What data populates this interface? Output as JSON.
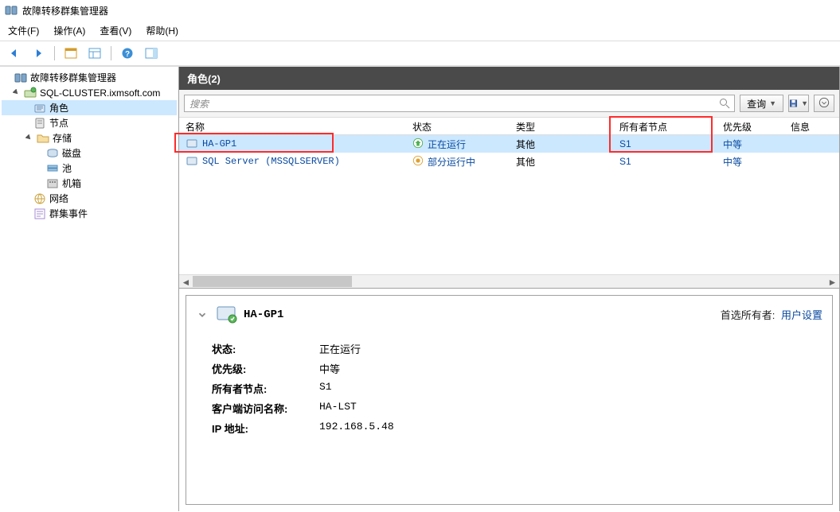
{
  "window": {
    "title": "故障转移群集管理器"
  },
  "menubar": {
    "file": "文件(F)",
    "action": "操作(A)",
    "view": "查看(V)",
    "help": "帮助(H)"
  },
  "tree": {
    "root": "故障转移群集管理器",
    "cluster": "SQL-CLUSTER.ixmsoft.com",
    "roles": "角色",
    "nodes": "节点",
    "storage": "存储",
    "disks": "磁盘",
    "pools": "池",
    "enclosures": "机箱",
    "networks": "网络",
    "events": "群集事件"
  },
  "panel": {
    "title": "角色(2)"
  },
  "search": {
    "placeholder": "搜索",
    "query_btn": "查询"
  },
  "columns": {
    "name": "名称",
    "status": "状态",
    "type": "类型",
    "owner": "所有者节点",
    "priority": "优先级",
    "info": "信息"
  },
  "rows": [
    {
      "name": "HA-GP1",
      "status": "正在运行",
      "type": "其他",
      "owner": "S1",
      "priority": "中等"
    },
    {
      "name": "SQL Server (MSSQLSERVER)",
      "status": "部分运行中",
      "type": "其他",
      "owner": "S1",
      "priority": "中等"
    }
  ],
  "details": {
    "selected_name": "HA-GP1",
    "preferred_label": "首选所有者:",
    "preferred_link": "用户设置",
    "fields": {
      "status_label": "状态:",
      "status_val": "正在运行",
      "priority_label": "优先级:",
      "priority_val": "中等",
      "owner_label": "所有者节点:",
      "owner_val": "S1",
      "client_label": "客户端访问名称:",
      "client_val": "HA-LST",
      "ip_label": "IP 地址:",
      "ip_val": "192.168.5.48"
    }
  }
}
